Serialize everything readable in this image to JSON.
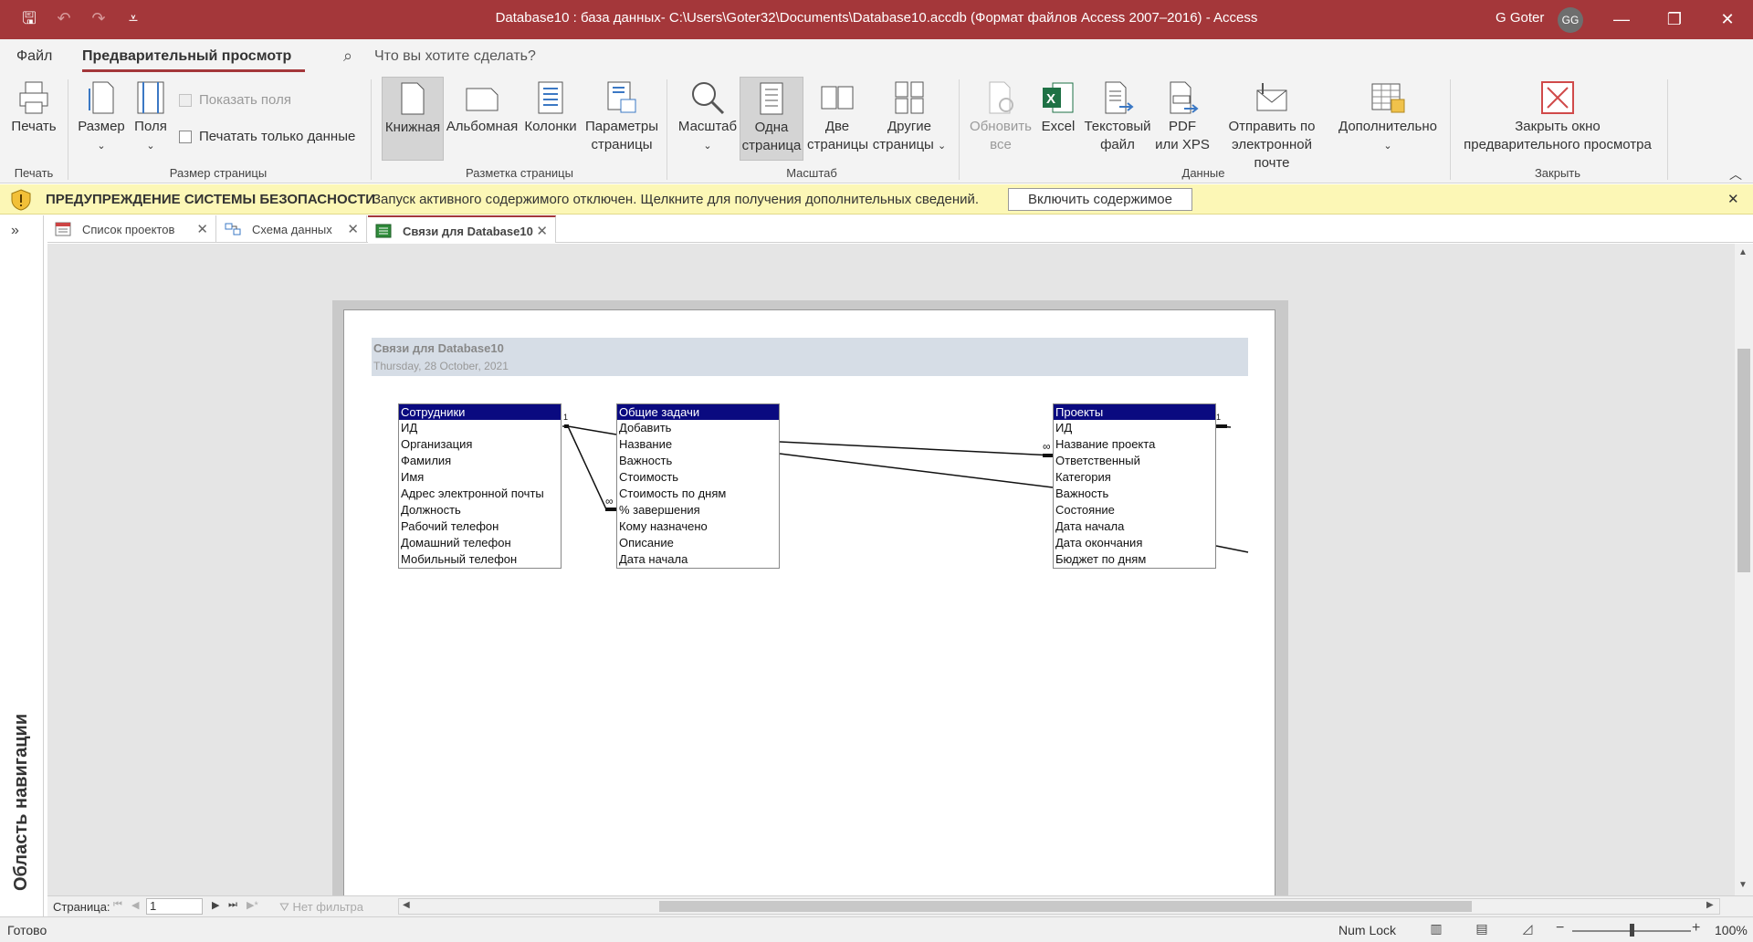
{
  "window": {
    "title": "Database10 : база данных- C:\\Users\\Goter32\\Documents\\Database10.accdb (Формат файлов Access 2007–2016)  -  Access",
    "user_name": "G Goter",
    "user_initials": "GG",
    "minimize": "—",
    "restore": "❐",
    "close": "✕"
  },
  "qat": {
    "save": "🖫",
    "undo": "↶",
    "redo": "↷",
    "customize": "⩡"
  },
  "menu": {
    "file": "Файл",
    "active_tab": "Предварительный просмотр",
    "tellme_placeholder": "Что вы хотите сделать?"
  },
  "ribbon": {
    "print": {
      "label": "Печать",
      "group": "Печать"
    },
    "page_size": {
      "size": "Размер",
      "margins": "Поля",
      "show_margins": "Показать поля",
      "print_data_only": "Печатать только данные",
      "group": "Размер страницы"
    },
    "layout": {
      "portrait": "Книжная",
      "landscape": "Альбомная",
      "columns": "Колонки",
      "page_setup_1": "Параметры",
      "page_setup_2": "страницы",
      "group": "Разметка страницы"
    },
    "zoom": {
      "zoom": "Масштаб",
      "one_page_1": "Одна",
      "one_page_2": "страница",
      "two_pages_1": "Две",
      "two_pages_2": "страницы",
      "more_pages_1": "Другие",
      "more_pages_2": "страницы",
      "group": "Масштаб"
    },
    "data": {
      "refresh_1": "Обновить",
      "refresh_2": "все",
      "excel": "Excel",
      "text_1": "Текстовый",
      "text_2": "файл",
      "pdf_1": "PDF",
      "pdf_2": "или XPS",
      "email_1": "Отправить по",
      "email_2": "электронной почте",
      "more": "Дополнительно",
      "group": "Данные"
    },
    "close": {
      "label_1": "Закрыть окно",
      "label_2": "предварительного просмотра",
      "group": "Закрыть"
    }
  },
  "security": {
    "title": "ПРЕДУПРЕЖДЕНИЕ СИСТЕМЫ БЕЗОПАСНОСТИ",
    "message": "Запуск активного содержимого отключен. Щелкните для получения дополнительных сведений.",
    "button": "Включить содержимое",
    "close": "✕"
  },
  "nav_pane": {
    "label": "Область навигации",
    "expand": "»"
  },
  "tabs": [
    {
      "label": "Список проектов",
      "close": "✕"
    },
    {
      "label": "Схема данных",
      "close": "✕"
    },
    {
      "label": "Связи для Database10",
      "close": "✕"
    }
  ],
  "report": {
    "title": "Связи для Database10",
    "date": "Thursday, 28 October, 2021",
    "tables": [
      {
        "name": "Сотрудники",
        "fields": [
          "ИД",
          "Организация",
          "Фамилия",
          "Имя",
          "Адрес электронной почты",
          "Должность",
          "Рабочий телефон",
          "Домашний телефон",
          "Мобильный телефон"
        ]
      },
      {
        "name": "Общие задачи",
        "fields": [
          "Добавить",
          "Название",
          "Важность",
          "Стоимость",
          "Стоимость по дням",
          "% завершения",
          "Кому назначено",
          "Описание",
          "Дата начала"
        ]
      },
      {
        "name": "Проекты",
        "fields": [
          "ИД",
          "Название проекта",
          "Ответственный",
          "Категория",
          "Важность",
          "Состояние",
          "Дата начала",
          "Дата окончания",
          "Бюджет по дням"
        ]
      }
    ],
    "rel_one": "1",
    "rel_many": "∞"
  },
  "record_nav": {
    "label": "Страница:",
    "page": "1",
    "filter": "Нет фильтра"
  },
  "status": {
    "text": "Готово",
    "numlock": "Num Lock",
    "zoom": "100%",
    "zoom_level": 0.5
  }
}
